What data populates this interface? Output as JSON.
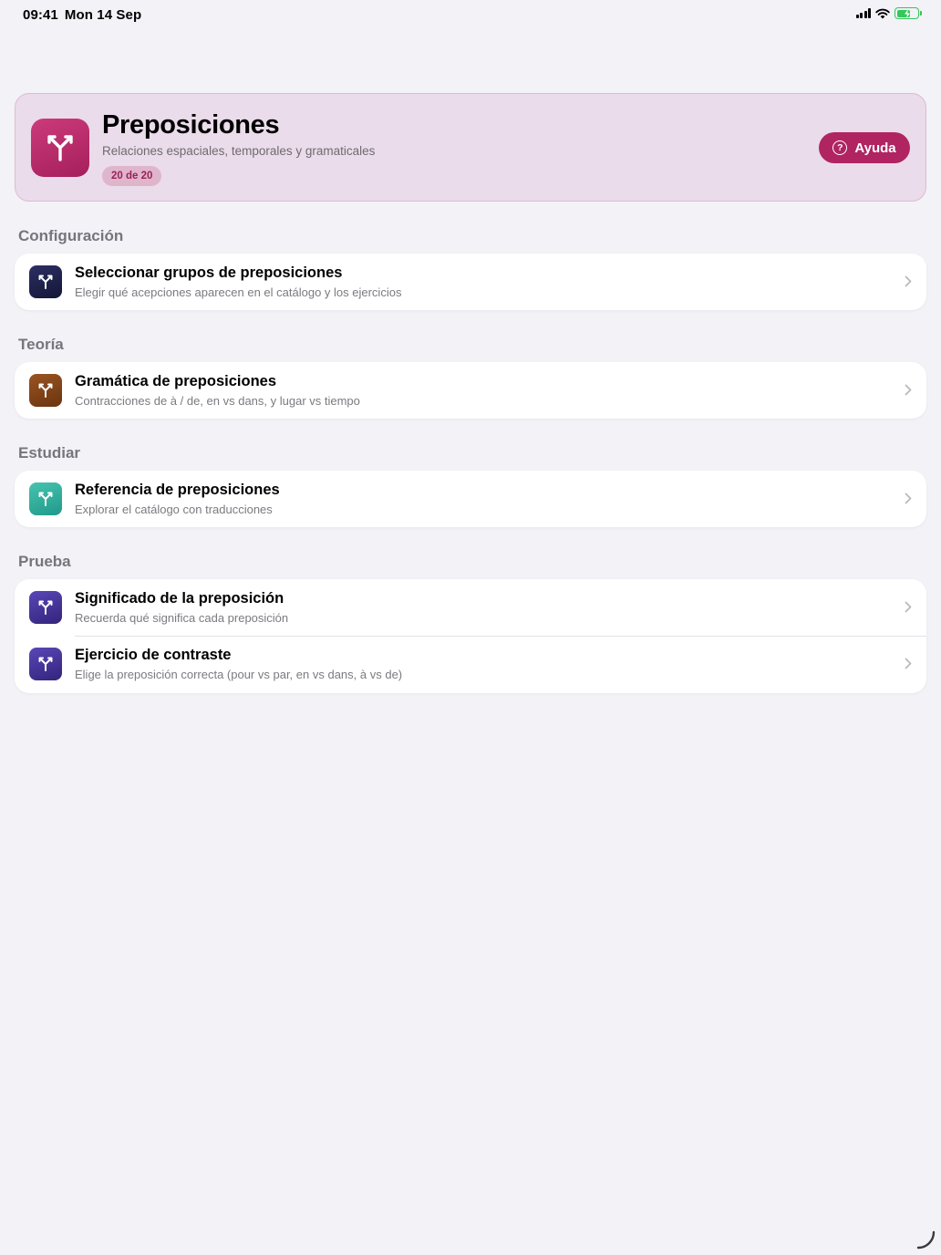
{
  "status": {
    "time": "09:41",
    "date": "Mon 14 Sep"
  },
  "header": {
    "title": "Preposiciones",
    "subtitle": "Relaciones espaciales, temporales y gramaticales",
    "badge": "20 de 20",
    "help_label": "Ayuda",
    "accent": "#b02462"
  },
  "sections": [
    {
      "title": "Configuración",
      "rows": [
        {
          "title": "Seleccionar grupos de preposiciones",
          "subtitle": "Elegir qué acepciones aparecen en el catálogo y los ejercicios",
          "icon": "fork-icon",
          "color": "#1c1f48"
        }
      ]
    },
    {
      "title": "Teoría",
      "rows": [
        {
          "title": "Gramática de preposiciones",
          "subtitle": "Contracciones de à / de, en vs dans, y lugar vs tiempo",
          "icon": "fork-icon",
          "color": "#7a3f16"
        }
      ]
    },
    {
      "title": "Estudiar",
      "rows": [
        {
          "title": "Referencia de preposiciones",
          "subtitle": "Explorar el catálogo con traducciones",
          "icon": "fork-icon",
          "color": "#2aa898"
        }
      ]
    },
    {
      "title": "Prueba",
      "rows": [
        {
          "title": "Significado de la preposición",
          "subtitle": "Recuerda qué significa cada preposición",
          "icon": "fork-icon",
          "color": "#3f2d92"
        },
        {
          "title": "Ejercicio de contraste",
          "subtitle": "Elige la preposición correcta (pour vs par, en vs dans, à vs de)",
          "icon": "fork-icon",
          "color": "#3f2d92"
        }
      ]
    }
  ]
}
